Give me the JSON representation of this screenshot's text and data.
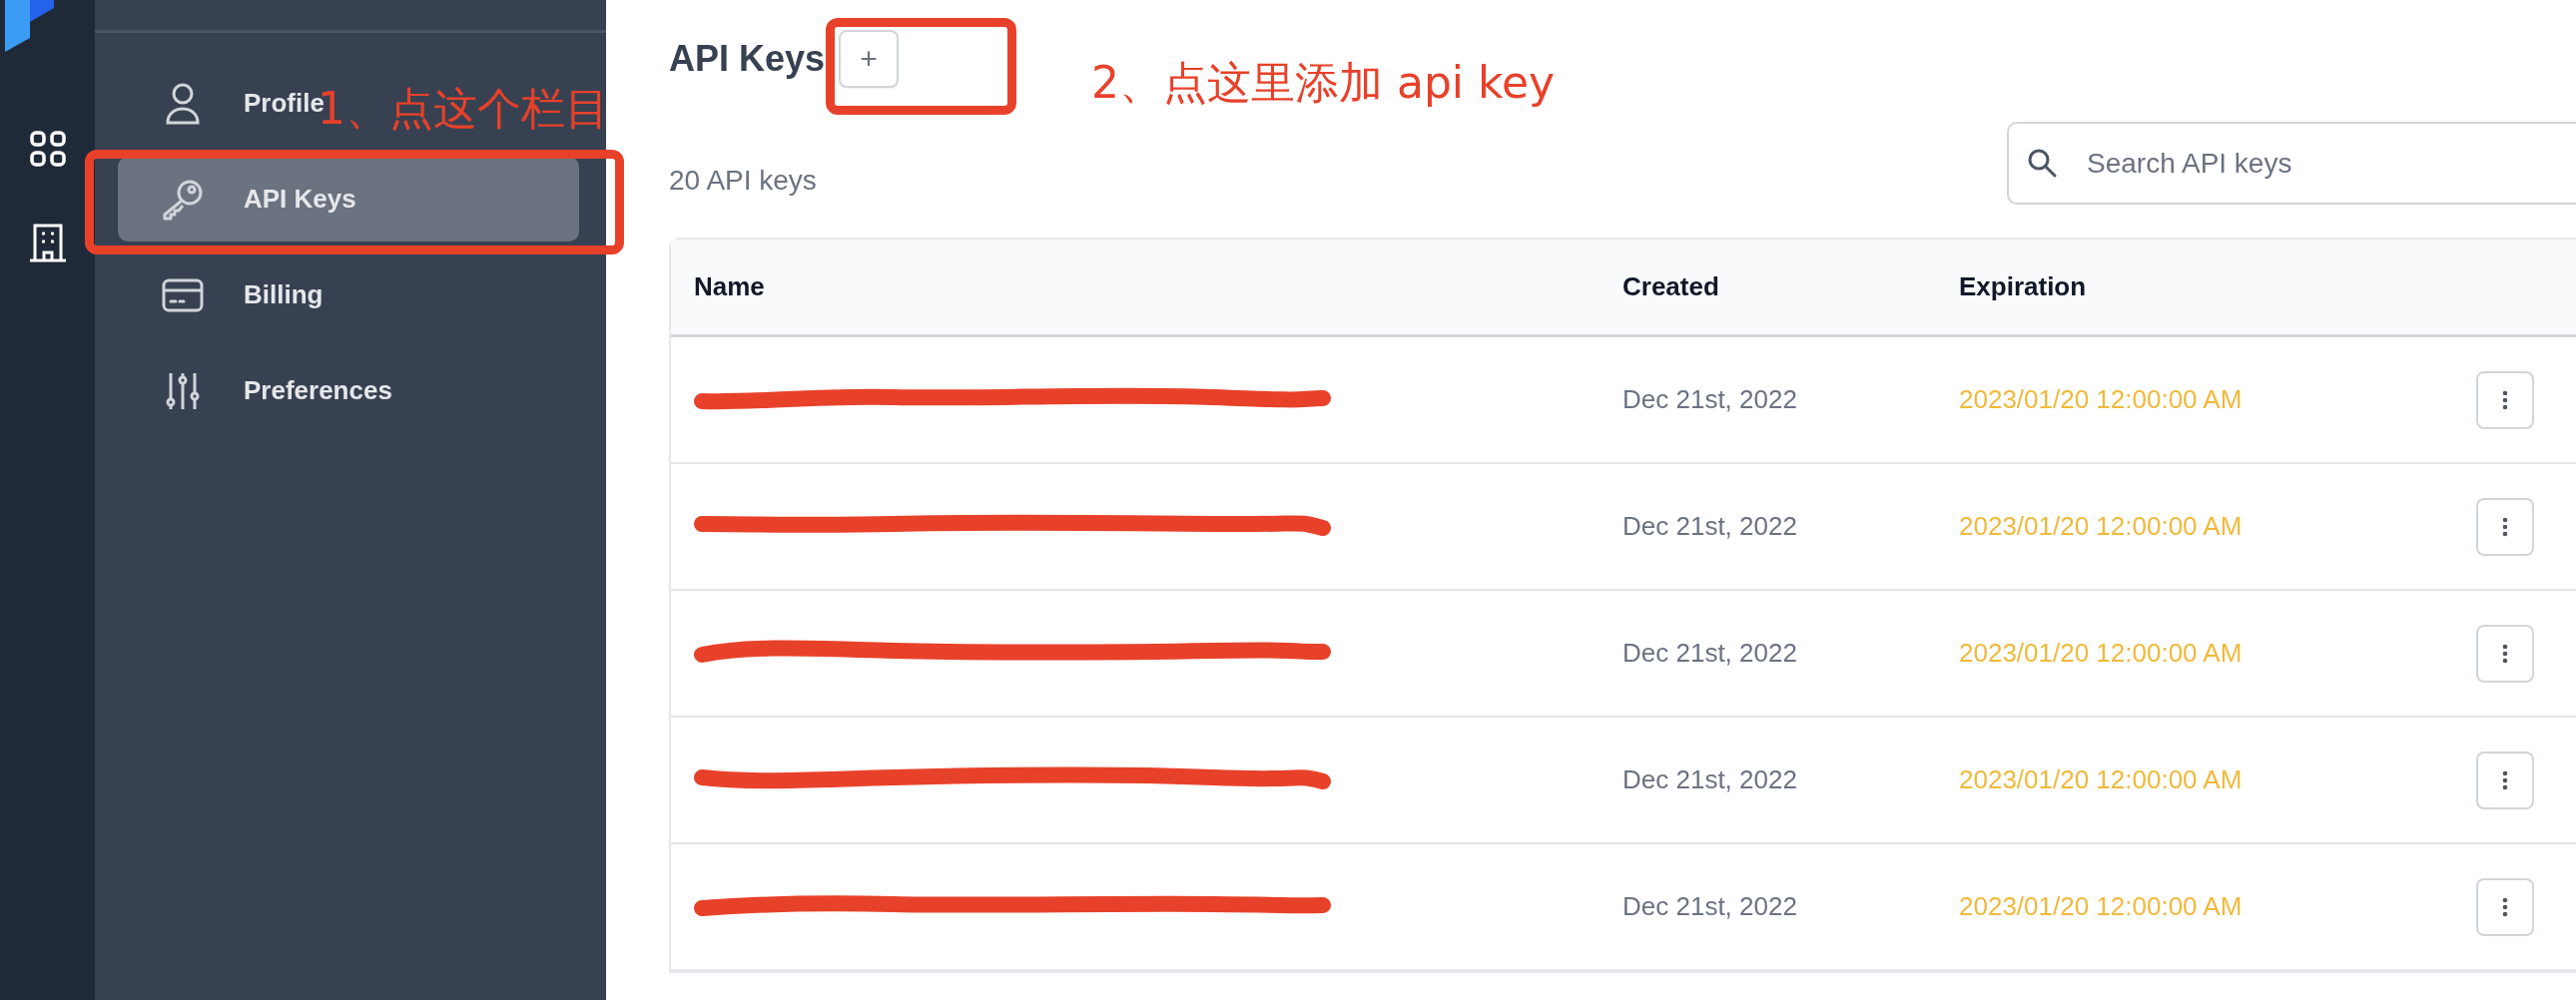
{
  "sidebar": {
    "items": [
      {
        "label": "Profile",
        "selected": false
      },
      {
        "label": "API Keys",
        "selected": true
      },
      {
        "label": "Billing",
        "selected": false
      },
      {
        "label": "Preferences",
        "selected": false
      }
    ]
  },
  "page": {
    "title": "API Keys",
    "add_button": "+",
    "count": "20 API keys",
    "search": {
      "placeholder": "Search API keys"
    }
  },
  "table": {
    "columns": [
      "Name",
      "Created",
      "Expiration"
    ],
    "rows": [
      {
        "name_redacted": true,
        "created": "Dec 21st, 2022",
        "expiration": "2023/01/20 12:00:00 AM"
      },
      {
        "name_redacted": true,
        "created": "Dec 21st, 2022",
        "expiration": "2023/01/20 12:00:00 AM"
      },
      {
        "name_redacted": true,
        "created": "Dec 21st, 2022",
        "expiration": "2023/01/20 12:00:00 AM"
      },
      {
        "name_redacted": true,
        "created": "Dec 21st, 2022",
        "expiration": "2023/01/20 12:00:00 AM"
      },
      {
        "name_redacted": true,
        "created": "Dec 21st, 2022",
        "expiration": "2023/01/20 12:00:00 AM"
      }
    ]
  },
  "annotations": [
    {
      "text": "1、点这个栏目"
    },
    {
      "text": "2、点这里添加 api key"
    }
  ]
}
